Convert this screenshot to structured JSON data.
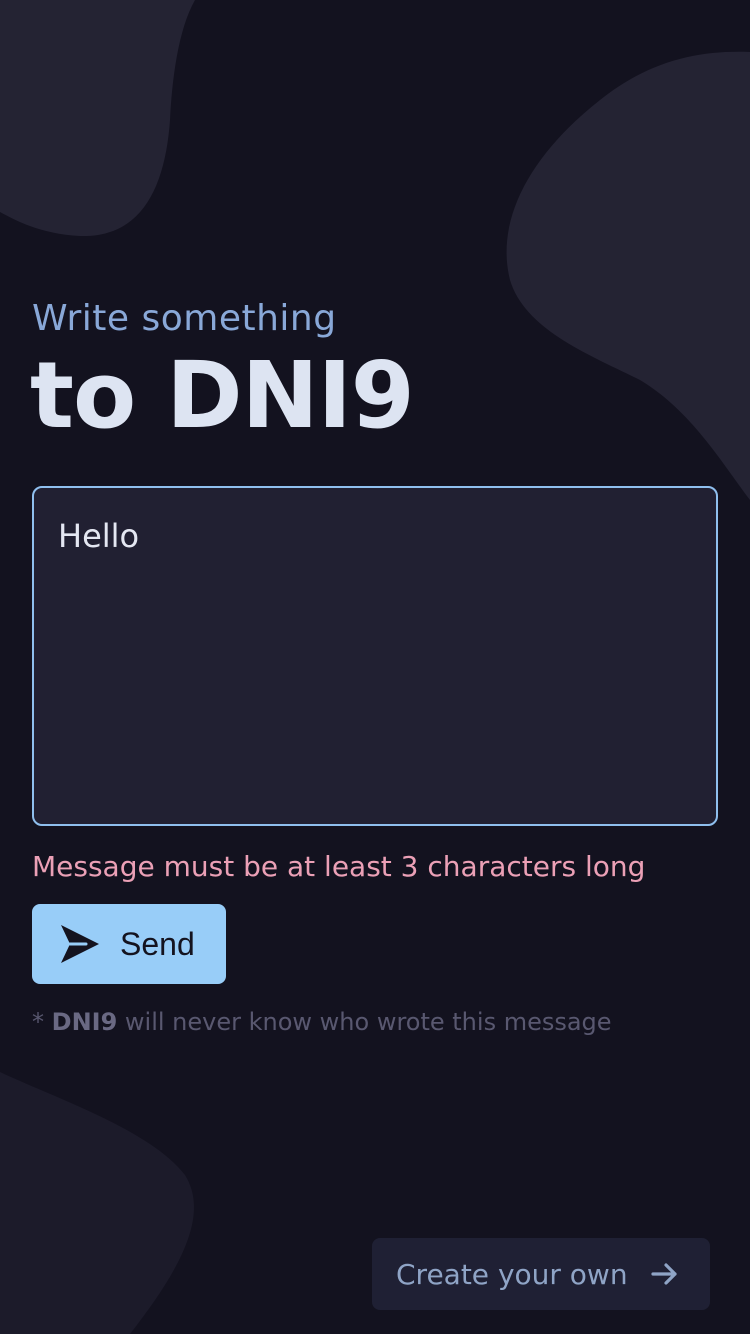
{
  "header": {
    "subtitle": "Write something",
    "title": "to DNI9"
  },
  "message": {
    "value": "Hello",
    "error": "Message must be at least 3 characters long"
  },
  "send_button": {
    "label": "Send",
    "icon": "send-icon"
  },
  "note": {
    "prefix": "* ",
    "recipient": "DNI9",
    "suffix": " will never know who wrote this message"
  },
  "create_button": {
    "label": "Create your own",
    "icon": "arrow-right-icon"
  },
  "colors": {
    "background": "#13121f",
    "accent": "#98cdf8",
    "error": "#eba0b6",
    "subtitle": "#89a8d8"
  }
}
